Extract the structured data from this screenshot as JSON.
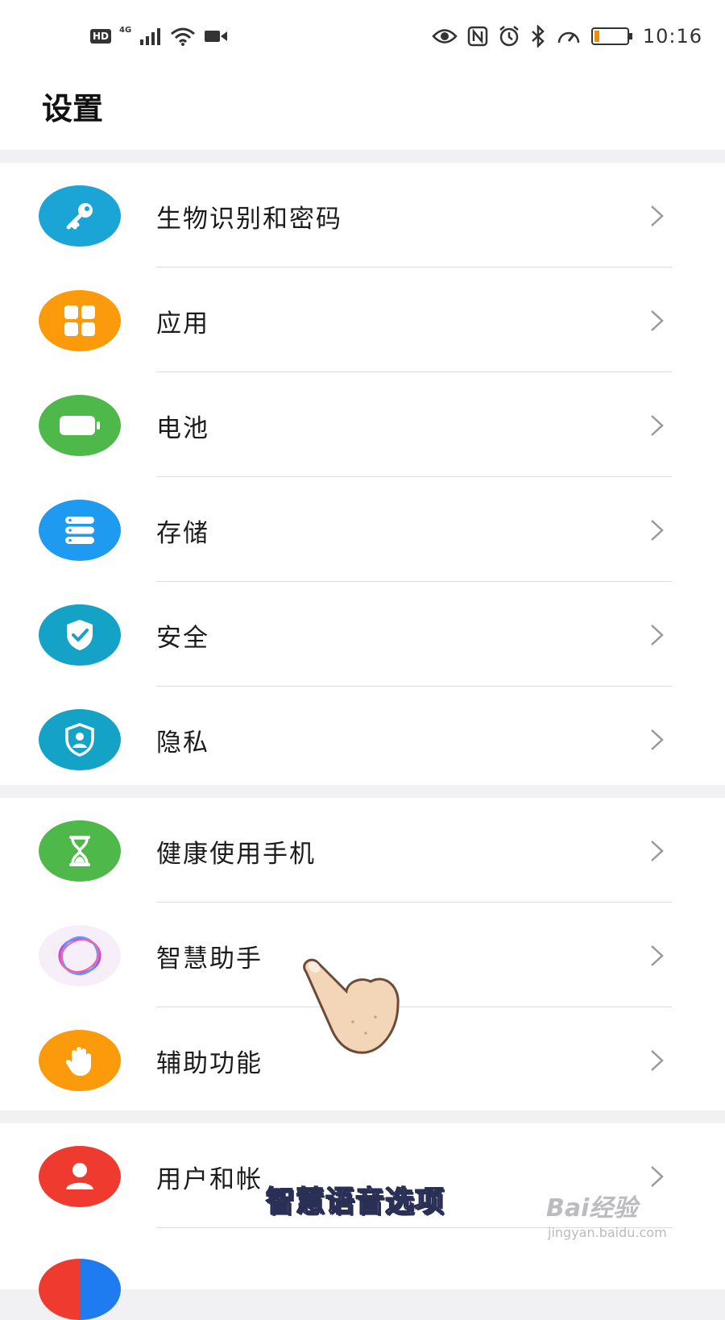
{
  "status_bar": {
    "hd": "HD",
    "net": "4G",
    "battery_text": "11",
    "time": "10:16",
    "icons": [
      "signal-icon",
      "wifi-icon",
      "video-icon",
      "eye-icon",
      "nfc-icon",
      "alarm-icon",
      "bluetooth-icon",
      "speed-icon",
      "battery-icon"
    ]
  },
  "header": {
    "title": "设置"
  },
  "groups": [
    {
      "items": [
        {
          "label": "生物识别和密码",
          "icon": "key-icon",
          "color": "#1ba4d6"
        },
        {
          "label": "应用",
          "icon": "apps-grid-icon",
          "color": "#fb9a0a"
        },
        {
          "label": "电池",
          "icon": "battery-icon",
          "color": "#4fb84a"
        },
        {
          "label": "存储",
          "icon": "storage-icon",
          "color": "#1e9bf0"
        },
        {
          "label": "安全",
          "icon": "shield-check-icon",
          "color": "#14a3c6"
        },
        {
          "label": "隐私",
          "icon": "privacy-shield-icon",
          "color": "#14a3c6"
        }
      ]
    },
    {
      "items": [
        {
          "label": "健康使用手机",
          "icon": "hourglass-icon",
          "color": "#4fb84a"
        },
        {
          "label": "智慧助手",
          "icon": "assistant-ring-icon",
          "color": "#f6eef8"
        },
        {
          "label": "辅助功能",
          "icon": "hand-icon",
          "color": "#fb9a0a"
        }
      ]
    },
    {
      "items": [
        {
          "label": "用户和帐",
          "icon": "user-icon",
          "color": "#ef3b2f"
        }
      ]
    }
  ],
  "overlay": {
    "subtitle": "智慧语音选项",
    "watermark_logo": "Bai经验",
    "watermark_url": "jingyan.baidu.com"
  }
}
